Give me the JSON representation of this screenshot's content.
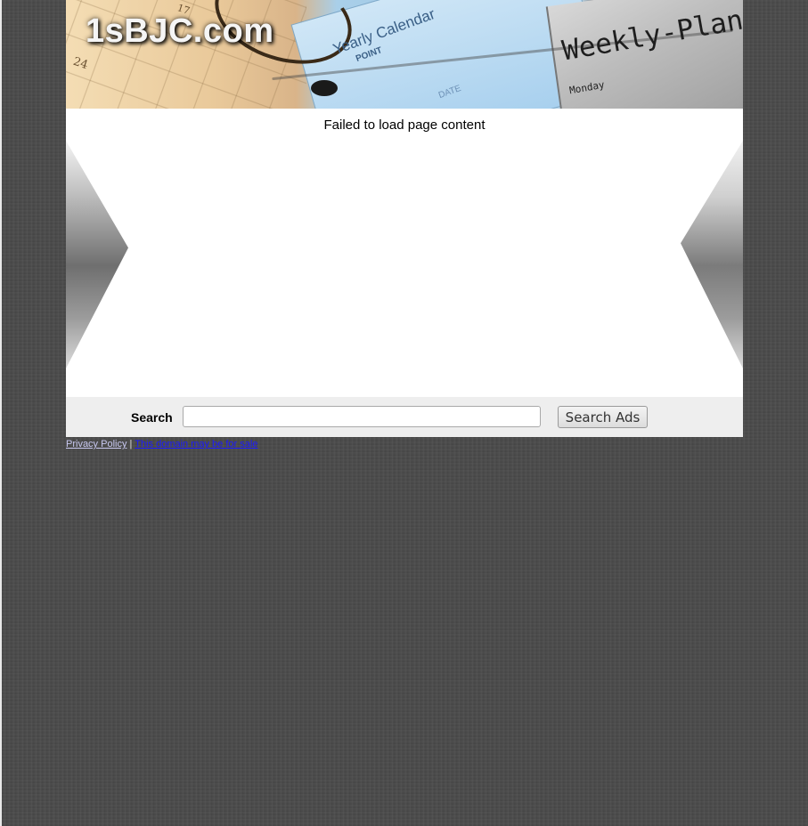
{
  "header": {
    "site_title": "1sBJC.com",
    "banner_texts": {
      "yearly_calendar": "Yearly Calendar",
      "point": "POINT",
      "date": "DATE",
      "weekly_plan": "Weekly-Plan",
      "monday": "Monday",
      "num_24": "24",
      "num_17": "17"
    }
  },
  "content": {
    "status_message": "Failed to load page content"
  },
  "search": {
    "label": "Search",
    "input_value": "",
    "button_label": "Search Ads"
  },
  "footer": {
    "privacy_link": "Privacy Policy",
    "separator": "|",
    "sale_link": "This domain may be for sale"
  },
  "colors": {
    "page_background": "#4a4a4a",
    "search_bar_background": "#eeeeee",
    "sale_link": "#1a1aff",
    "privacy_link": "#c8c8f0"
  }
}
